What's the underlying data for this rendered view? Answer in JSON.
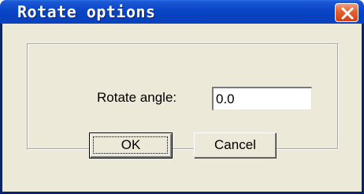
{
  "dialog": {
    "title": "Rotate options",
    "close_icon": "close-icon",
    "angle_label": "Rotate angle:",
    "angle_value": "0.0",
    "ok_label": "OK",
    "cancel_label": "Cancel"
  },
  "colors": {
    "titlebar": "#0b47c8",
    "close_button": "#e2612f",
    "face": "#ece9d8"
  }
}
